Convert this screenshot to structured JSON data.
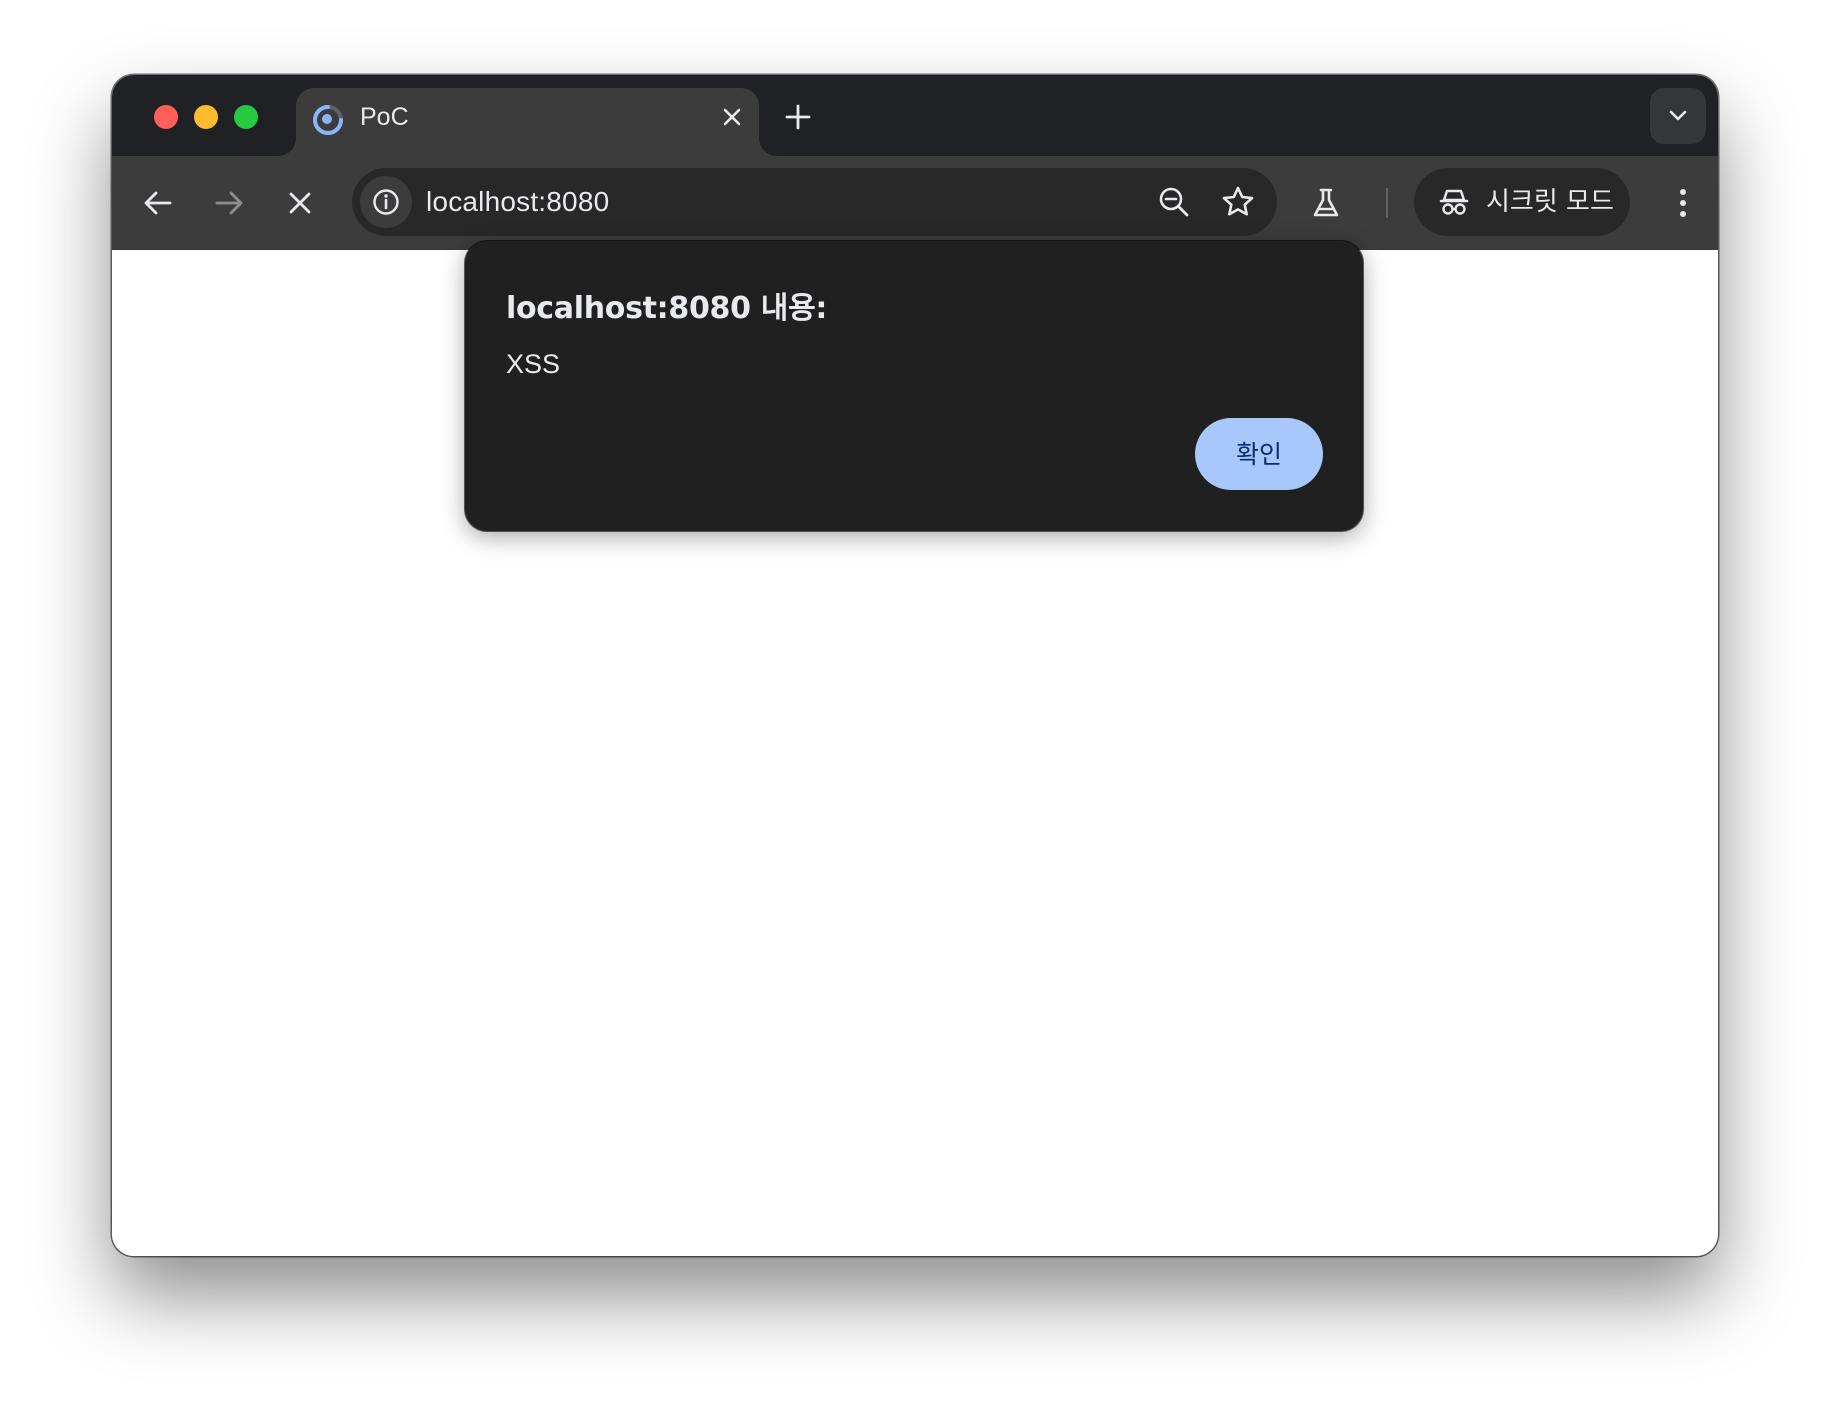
{
  "tab": {
    "title": "PoC",
    "favicon": "loading-spinner-icon"
  },
  "toolbar": {
    "url": "localhost:8080",
    "incognito_label": "시크릿 모드"
  },
  "dialog": {
    "title": "localhost:8080 내용:",
    "message": "XSS",
    "ok_label": "확인"
  },
  "colors": {
    "tabstrip_bg": "#202124",
    "toolbar_bg": "#3c3c3c",
    "omnibox_bg": "#282828",
    "dialog_bg": "#202020",
    "accent_button": "#a8c7fa",
    "accent_button_text": "#062e6f"
  }
}
